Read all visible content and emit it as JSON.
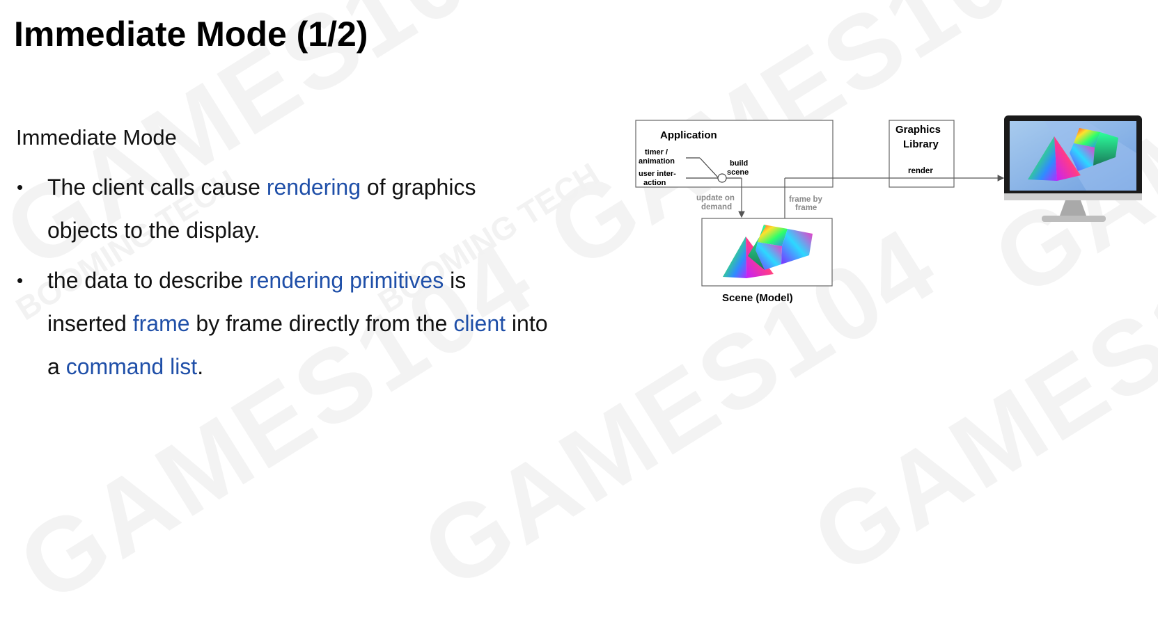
{
  "watermark": {
    "text": "GAMES104",
    "sub": "BOOMING TECH"
  },
  "slide": {
    "title": "Immediate Mode (1/2)",
    "subheading": "Immediate Mode",
    "bullets": [
      {
        "segments": [
          {
            "text": "The client calls cause ",
            "hl": false
          },
          {
            "text": "rendering",
            "hl": true
          },
          {
            "text": " of graphics objects to the display.",
            "hl": false
          }
        ]
      },
      {
        "segments": [
          {
            "text": "the data to describe ",
            "hl": false
          },
          {
            "text": "rendering primitives",
            "hl": true
          },
          {
            "text": " is inserted ",
            "hl": false
          },
          {
            "text": "frame",
            "hl": true
          },
          {
            "text": " by frame directly from the ",
            "hl": false
          },
          {
            "text": "client",
            "hl": true
          },
          {
            "text": " into a ",
            "hl": false
          },
          {
            "text": "command list",
            "hl": true
          },
          {
            "text": ".",
            "hl": false
          }
        ]
      }
    ],
    "highlight_color": "#1f4fa8"
  },
  "diagram": {
    "application_label": "Application",
    "timer_label_1": "timer /",
    "timer_label_2": "animation",
    "user_label_1": "user inter-",
    "user_label_2": "action",
    "build_label_1": "build",
    "build_label_2": "scene",
    "graphics_library_label_1": "Graphics",
    "graphics_library_label_2": "Library",
    "render_label": "render",
    "update_label_1": "update on",
    "update_label_2": "demand",
    "frame_label_1": "frame by",
    "frame_label_2": "frame",
    "scene_label": "Scene (Model)"
  }
}
